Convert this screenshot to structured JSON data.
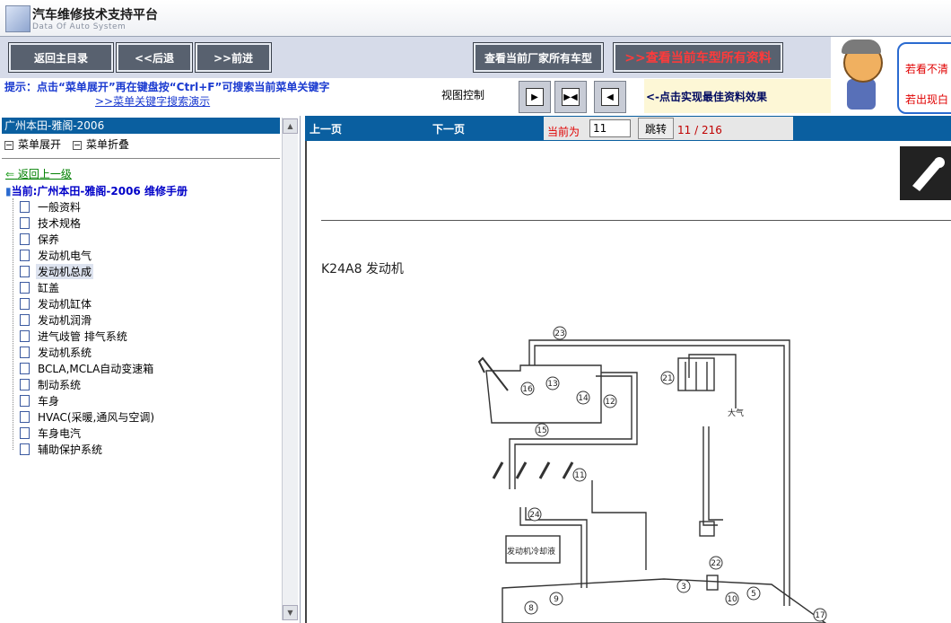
{
  "app": {
    "title": "汽车维修技术支持平台",
    "subtitle": "Data Of Auto System"
  },
  "toolbar": {
    "home": "返回主目录",
    "back": "<<后退",
    "forward": ">>前进",
    "all_models": "查看当前厂家所有车型",
    "all_docs": ">>查看当前车型所有资料"
  },
  "bubble": {
    "line1": "若看不清",
    "line2": "若出现白"
  },
  "hint": {
    "text": "提示：点击“菜单展开”再在键盘按“Ctrl+F”可搜索当前菜单关键字",
    "demo_link": ">>菜单关键字搜索演示"
  },
  "view_control": {
    "label": "视图控制",
    "best_effect": "<-点击实现最佳资料效果"
  },
  "left_panel": {
    "header": "广州本田-雅阁-2006",
    "expand": "菜单展开",
    "collapse": "菜单折叠",
    "back_up": "返回上一级",
    "current": "当前:广州本田-雅阁-2006 维修手册",
    "items": [
      {
        "label": "一般资料"
      },
      {
        "label": "技术规格"
      },
      {
        "label": "保养"
      },
      {
        "label": "发动机电气"
      },
      {
        "label": "发动机总成"
      },
      {
        "label": "缸盖"
      },
      {
        "label": "发动机缸体"
      },
      {
        "label": "发动机润滑"
      },
      {
        "label": "进气歧管 排气系统"
      },
      {
        "label": "发动机系统"
      },
      {
        "label": "BCLA,MCLA自动变速箱"
      },
      {
        "label": "制动系统"
      },
      {
        "label": "车身"
      },
      {
        "label": "HVAC(采暖,通风与空调)"
      },
      {
        "label": "车身电汽"
      },
      {
        "label": "辅助保护系统"
      }
    ],
    "selected_index": 4
  },
  "viewer": {
    "prev": "上一页",
    "next": "下一页",
    "current_label": "当前为",
    "page_value": "11",
    "jump": "跳转",
    "page_count": "11 / 216",
    "doc_heading": "K24A8 发动机",
    "diagram_labels": {
      "atmosphere": "大气",
      "coolant": "发动机冷却液",
      "callouts": [
        "23",
        "16",
        "13",
        "14",
        "12",
        "21",
        "15",
        "11",
        "24",
        "22",
        "3",
        "10",
        "5",
        "9",
        "8",
        "17"
      ]
    }
  }
}
